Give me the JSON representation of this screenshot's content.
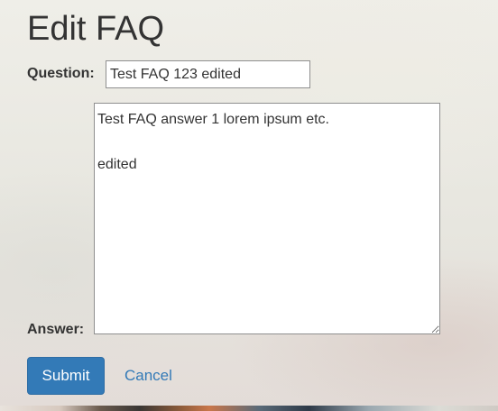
{
  "page": {
    "title": "Edit FAQ"
  },
  "form": {
    "question_label": "Question:",
    "question_value": "Test FAQ 123 edited",
    "answer_label": "Answer:",
    "answer_value": "Test FAQ answer 1 lorem ipsum etc.\n\nedited",
    "submit_label": "Submit",
    "cancel_label": "Cancel"
  },
  "colors": {
    "primary": "#337ab7",
    "text": "#333333"
  }
}
